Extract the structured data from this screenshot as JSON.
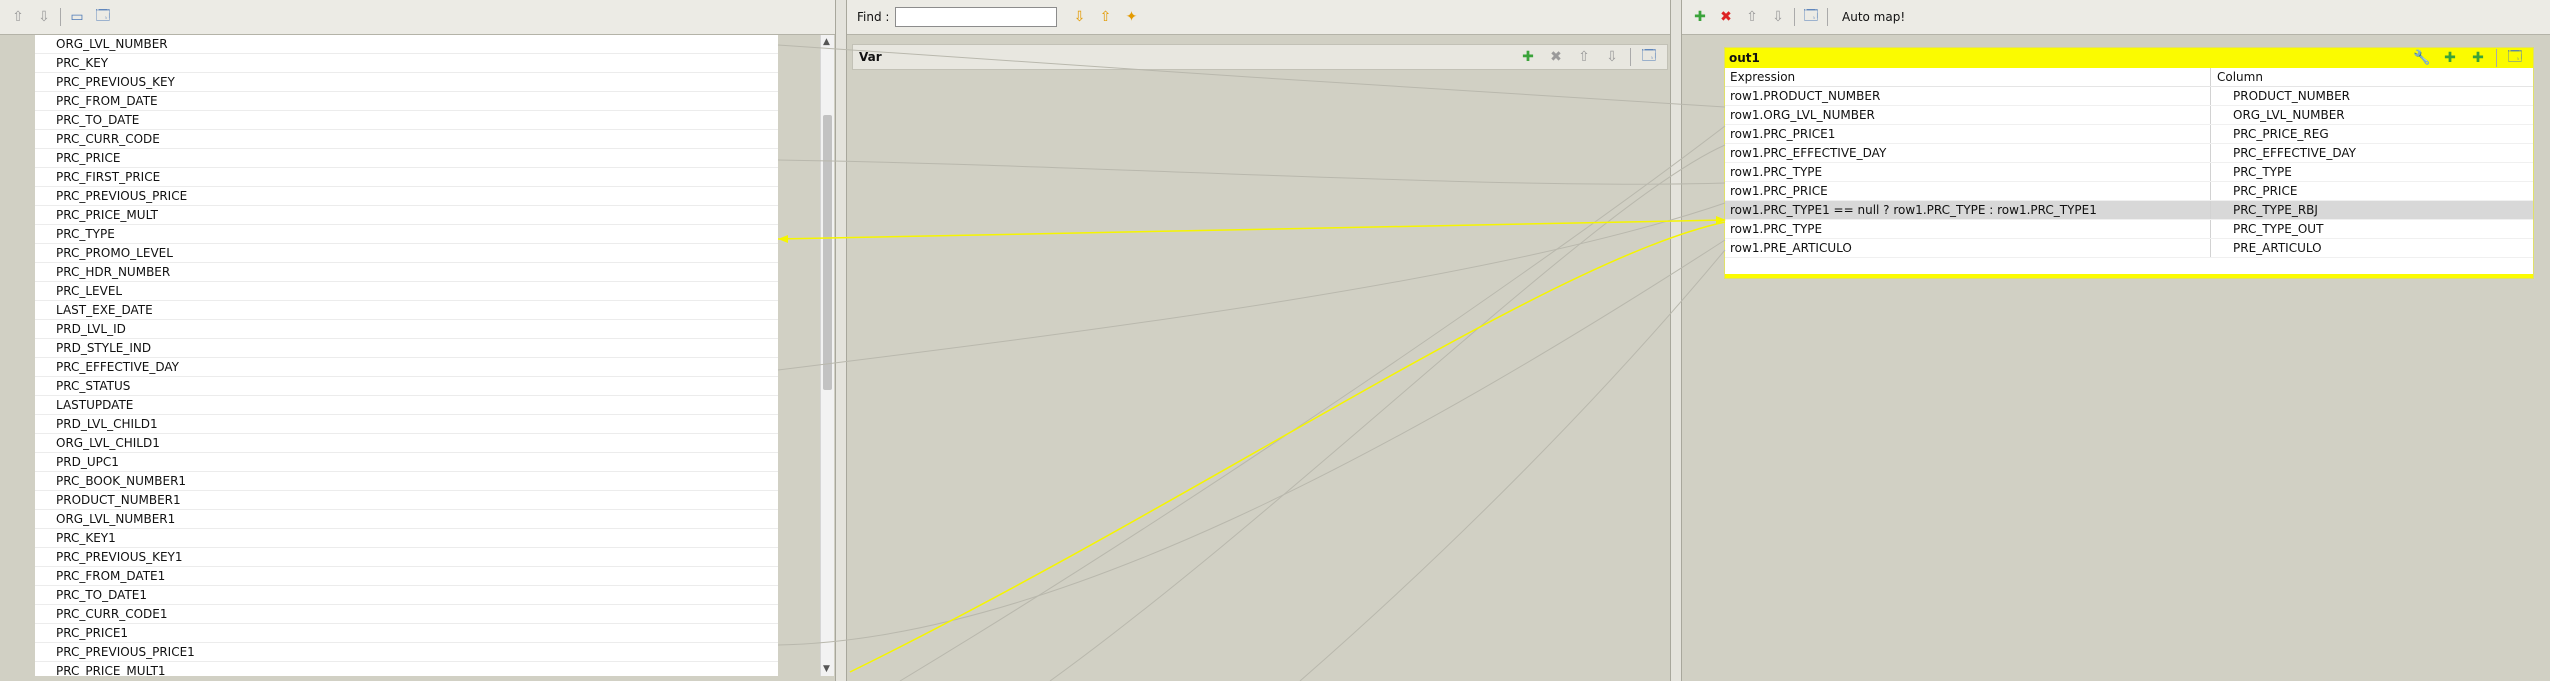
{
  "left_panel": {
    "toolbar_icons": [
      "arrow-up-icon",
      "arrow-down-icon",
      "window-icon",
      "monitor-icon"
    ],
    "fields": [
      "ORG_LVL_NUMBER",
      "PRC_KEY",
      "PRC_PREVIOUS_KEY",
      "PRC_FROM_DATE",
      "PRC_TO_DATE",
      "PRC_CURR_CODE",
      "PRC_PRICE",
      "PRC_FIRST_PRICE",
      "PRC_PREVIOUS_PRICE",
      "PRC_PRICE_MULT",
      "PRC_TYPE",
      "PRC_PROMO_LEVEL",
      "PRC_HDR_NUMBER",
      "PRC_LEVEL",
      "LAST_EXE_DATE",
      "PRD_LVL_ID",
      "PRD_STYLE_IND",
      "PRC_EFFECTIVE_DAY",
      "PRC_STATUS",
      "LASTUPDATE",
      "PRD_LVL_CHILD1",
      "ORG_LVL_CHILD1",
      "PRD_UPC1",
      "PRC_BOOK_NUMBER1",
      "PRODUCT_NUMBER1",
      "ORG_LVL_NUMBER1",
      "PRC_KEY1",
      "PRC_PREVIOUS_KEY1",
      "PRC_FROM_DATE1",
      "PRC_TO_DATE1",
      "PRC_CURR_CODE1",
      "PRC_PRICE1",
      "PRC_PREVIOUS_PRICE1",
      "PRC_PRICE_MULT1"
    ]
  },
  "middle_panel": {
    "find_label": "Find :",
    "find_value": "",
    "var_title": "Var"
  },
  "right_panel": {
    "auto_map_label": "Auto map!",
    "out_title": "out1",
    "expression_header": "Expression",
    "column_header": "Column",
    "rows": [
      {
        "expression": "row1.PRODUCT_NUMBER",
        "column": "PRODUCT_NUMBER"
      },
      {
        "expression": "row1.ORG_LVL_NUMBER",
        "column": "ORG_LVL_NUMBER"
      },
      {
        "expression": "row1.PRC_PRICE1",
        "column": "PRC_PRICE_REG"
      },
      {
        "expression": "row1.PRC_EFFECTIVE_DAY",
        "column": "PRC_EFFECTIVE_DAY"
      },
      {
        "expression": "row1.PRC_TYPE",
        "column": "PRC_TYPE"
      },
      {
        "expression": "row1.PRC_PRICE",
        "column": "PRC_PRICE"
      },
      {
        "expression": "row1.PRC_TYPE1 == null ? row1.PRC_TYPE : row1.PRC_TYPE1",
        "column": "PRC_TYPE_RBJ"
      },
      {
        "expression": "row1.PRC_TYPE",
        "column": "PRC_TYPE_OUT"
      },
      {
        "expression": "row1.PRE_ARTICULO",
        "column": "PRE_ARTICULO"
      }
    ],
    "selected_row": 6
  },
  "colors": {
    "highlight_yellow": "#fbfb00",
    "link_yellow": "#f5f500",
    "link_gray": "#b9b8ad",
    "background": "#d1d0c4"
  }
}
